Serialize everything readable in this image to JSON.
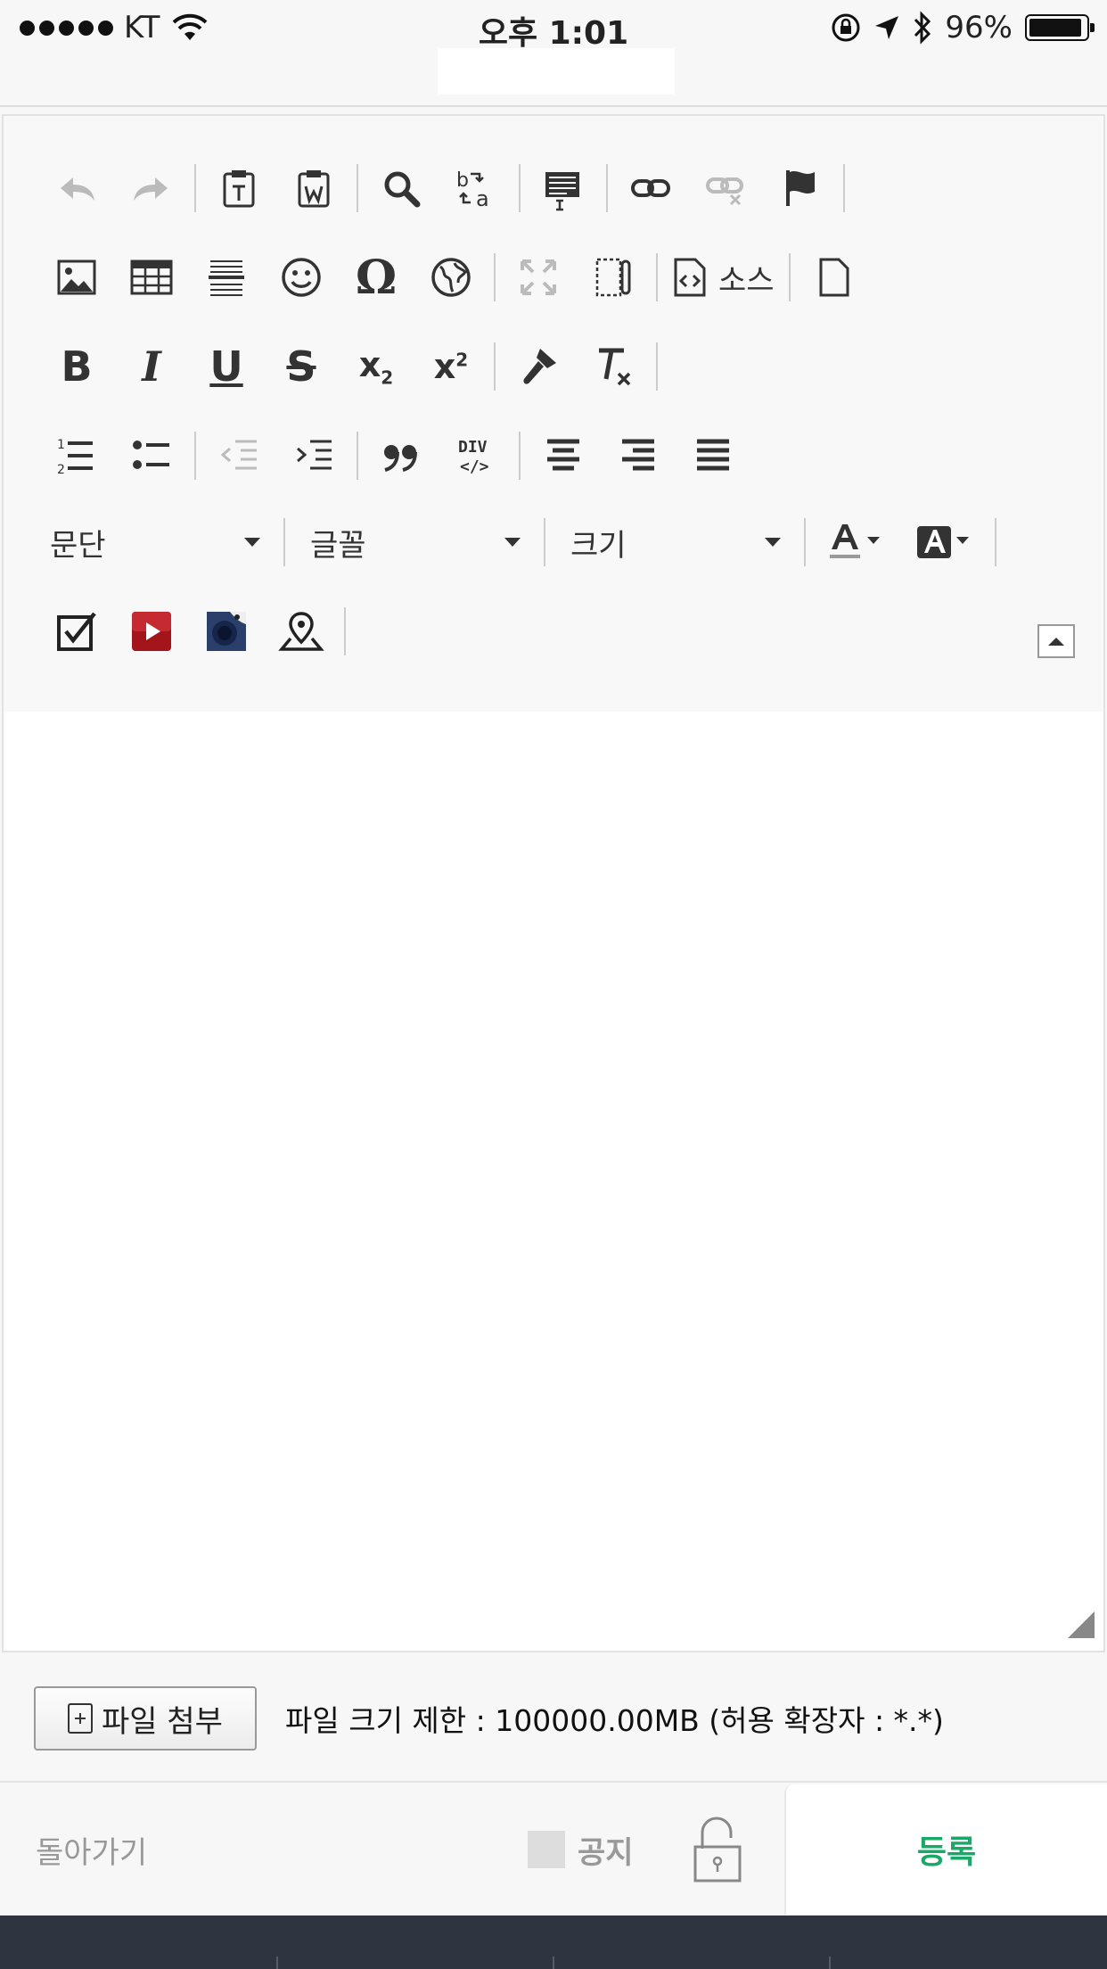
{
  "status_bar": {
    "carrier": "KT",
    "time": "오후 1:01",
    "battery": "96%"
  },
  "toolbar": {
    "source_label": "소스",
    "format_select": "문단",
    "font_select": "글꼴",
    "size_select": "크기",
    "icons": {
      "row1": [
        "undo-icon",
        "redo-icon",
        "paste-text-icon",
        "paste-word-icon",
        "find-icon",
        "replace-icon",
        "select-all-icon",
        "link-icon",
        "unlink-icon",
        "anchor-flag-icon"
      ],
      "row2": [
        "image-icon",
        "table-icon",
        "horizontal-rule-icon",
        "smiley-icon",
        "special-char-icon",
        "iframe-globe-icon",
        "maximize-icon",
        "show-blocks-icon",
        "source-icon",
        "new-page-icon"
      ],
      "row3": [
        "bold-icon",
        "italic-icon",
        "underline-icon",
        "strike-icon",
        "subscript-icon",
        "superscript-icon",
        "copy-format-icon",
        "remove-format-icon"
      ],
      "row4": [
        "numbered-list-icon",
        "bulleted-list-icon",
        "outdent-icon",
        "indent-icon",
        "blockquote-icon",
        "div-container-icon",
        "align-center-icon",
        "align-right-icon",
        "justify-icon"
      ],
      "row5": [
        "text-color-icon",
        "background-color-icon"
      ],
      "row6": [
        "checkbox-icon",
        "video-icon",
        "photo-icon",
        "map-icon",
        "collapse-toolbar-icon"
      ]
    }
  },
  "attach": {
    "button_label": "파일 첨부",
    "info": "파일 크기 제한 : 100000.00MB (허용 확장자 : *.*)"
  },
  "actions": {
    "back_label": "돌아가기",
    "notice_label": "공지",
    "submit_label": "등록"
  },
  "colors": {
    "accent_green": "#1aa867",
    "tabbar": "#2e3440"
  }
}
